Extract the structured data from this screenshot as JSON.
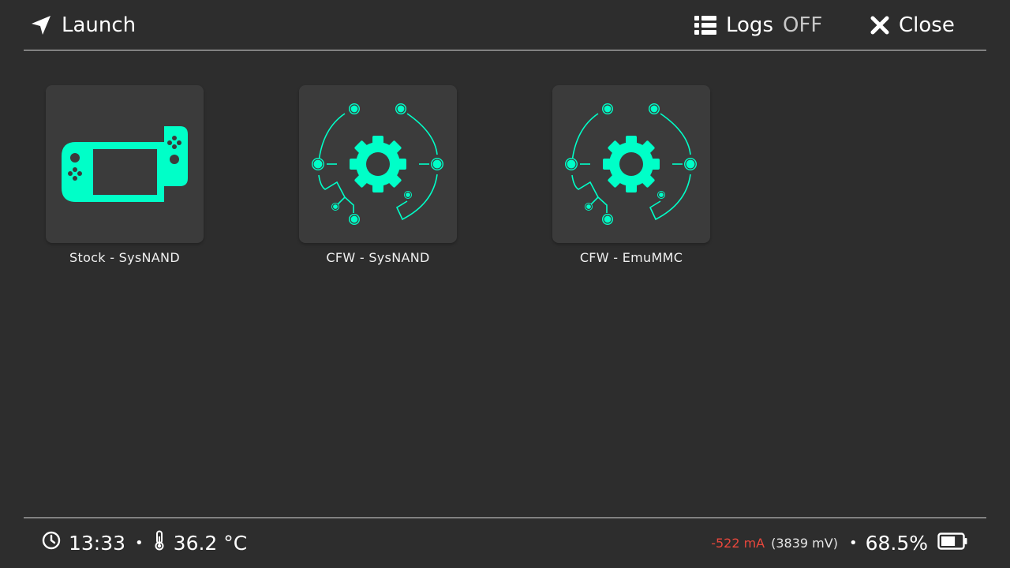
{
  "header": {
    "launch_label": "Launch",
    "logs_label": "Logs",
    "logs_state": "OFF",
    "close_label": "Close"
  },
  "entries": [
    {
      "label": "Stock - SysNAND",
      "icon": "handheld-console-icon"
    },
    {
      "label": "CFW - SysNAND",
      "icon": "gear-circuit-icon"
    },
    {
      "label": "CFW - EmuMMC",
      "icon": "gear-circuit-icon"
    }
  ],
  "footer": {
    "time": "13:33",
    "separator": "•",
    "temperature": "36.2 °C",
    "current": "-522 mA",
    "voltage": "(3839 mV)",
    "battery_percent": "68.5%",
    "battery_level": 0.685
  },
  "colors": {
    "background": "#2d2d2d",
    "tile": "#3b3b3b",
    "accent": "#00ffc8",
    "current_text": "#e8473c",
    "divider": "#d8d8d8"
  }
}
